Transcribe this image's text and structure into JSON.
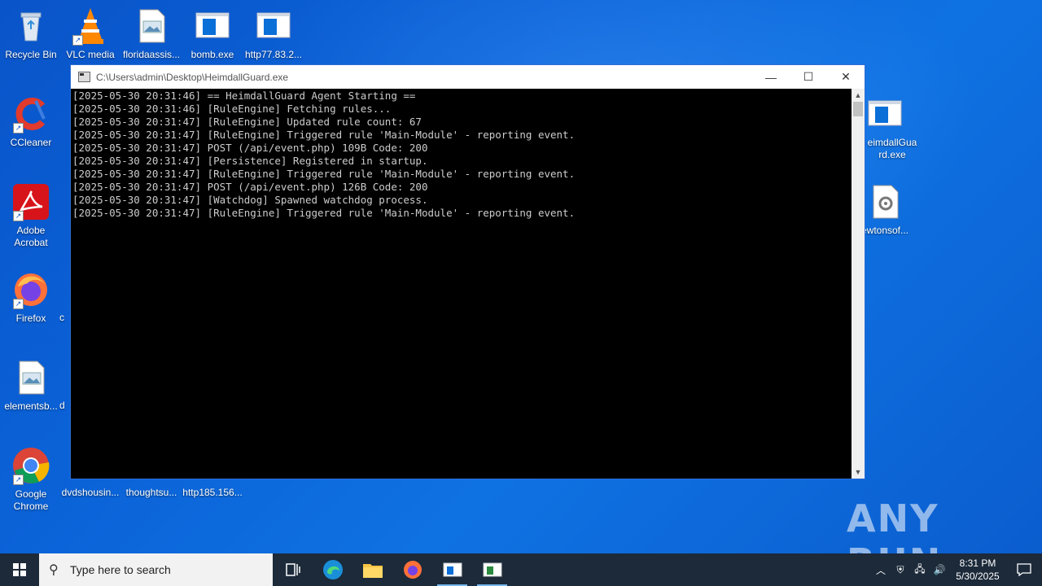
{
  "desktop": {
    "icons_left": [
      {
        "label": "Recycle Bin",
        "icon": "recycle-bin-icon"
      },
      {
        "label": "CCleaner",
        "icon": "ccleaner-icon"
      },
      {
        "label": "Adobe Acrobat",
        "icon": "acrobat-icon"
      },
      {
        "label": "Firefox",
        "icon": "firefox-icon"
      },
      {
        "label": "elementsb...",
        "icon": "image-file-icon"
      },
      {
        "label": "Google Chrome",
        "icon": "chrome-icon"
      }
    ],
    "icons_top": [
      {
        "label": "VLC media",
        "icon": "vlc-icon"
      },
      {
        "label": "floridaassis...",
        "icon": "image-file-icon"
      },
      {
        "label": "bomb.exe",
        "icon": "exe-icon"
      },
      {
        "label": "http77.83.2...",
        "icon": "exe-icon"
      }
    ],
    "icons_bottom": [
      {
        "label": "dvdshousin...",
        "icon": "file-icon"
      },
      {
        "label": "thoughtsu...",
        "icon": "file-icon"
      },
      {
        "label": "http185.156...",
        "icon": "file-icon"
      }
    ],
    "icons_right": [
      {
        "label": "eimdallGua rd.exe",
        "icon": "exe-icon"
      },
      {
        "label": "ewtonsof...",
        "icon": "settings-file-icon"
      }
    ],
    "partial_labels": [
      "c",
      "d"
    ]
  },
  "window": {
    "title": "C:\\Users\\admin\\Desktop\\HeimdallGuard.exe",
    "minimize": "—",
    "maximize": "☐",
    "close": "✕",
    "console_lines": [
      "[2025-05-30 20:31:46] == HeimdallGuard Agent Starting ==",
      "[2025-05-30 20:31:46] [RuleEngine] Fetching rules...",
      "[2025-05-30 20:31:47] [RuleEngine] Updated rule count: 67",
      "[2025-05-30 20:31:47] [RuleEngine] Triggered rule 'Main-Module' - reporting event.",
      "[2025-05-30 20:31:47] POST (/api/event.php) 109B Code: 200",
      "[2025-05-30 20:31:47] [Persistence] Registered in startup.",
      "[2025-05-30 20:31:47] [RuleEngine] Triggered rule 'Main-Module' - reporting event.",
      "[2025-05-30 20:31:47] POST (/api/event.php) 126B Code: 200",
      "[2025-05-30 20:31:47] [Watchdog] Spawned watchdog process.",
      "[2025-05-30 20:31:47] [RuleEngine] Triggered rule 'Main-Module' - reporting event."
    ]
  },
  "watermark": {
    "text": "ANY RUN"
  },
  "taskbar": {
    "search_placeholder": "Type here to search",
    "pinned": [
      "task-view-icon",
      "edge-icon",
      "file-explorer-icon",
      "firefox-icon",
      "console-app-icon",
      "console-app-icon"
    ],
    "time": "8:31 PM",
    "date": "5/30/2025"
  },
  "colors": {
    "desktop": "#0b63d8",
    "taskbar": "#1c2a3a",
    "console_bg": "#000000",
    "console_text": "#cccccc"
  }
}
